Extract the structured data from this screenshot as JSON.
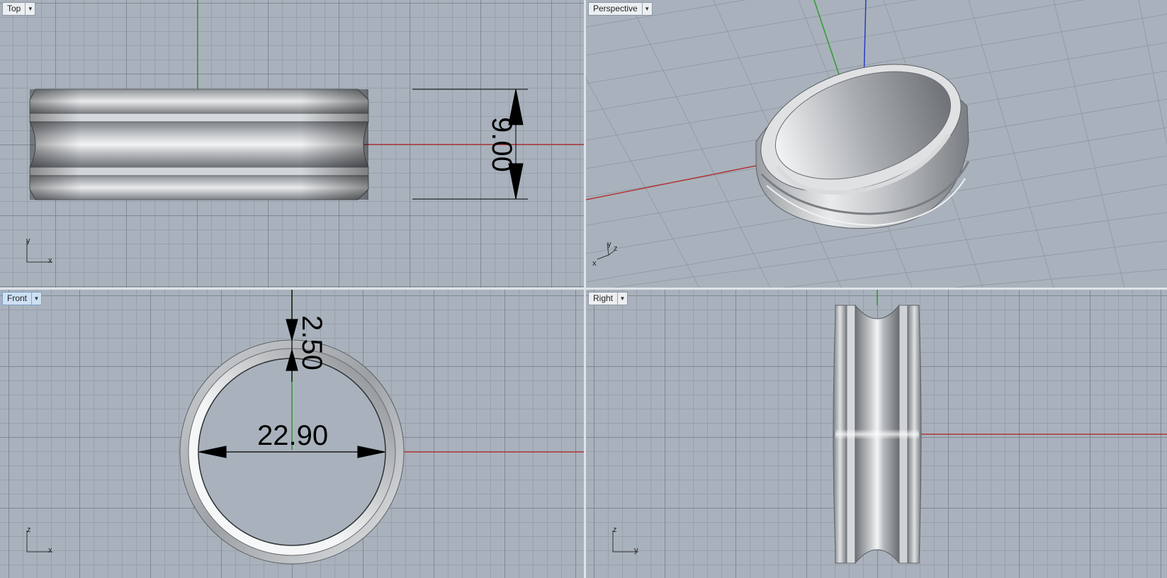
{
  "viewports": [
    {
      "name": "Top",
      "axes": [
        "y",
        "x"
      ]
    },
    {
      "name": "Perspective",
      "axes": [
        "y",
        "z",
        "x"
      ]
    },
    {
      "name": "Front",
      "axes": [
        "z",
        "x"
      ]
    },
    {
      "name": "Right",
      "axes": [
        "z",
        "y"
      ]
    }
  ],
  "dimensions": {
    "top_width": "9.00",
    "front_thickness": "2.50",
    "front_diameter": "22.90"
  },
  "colors": {
    "viewport_bg": "#a9b2bc",
    "grid_major": "#7f8893",
    "grid_minor": "#98a1ab",
    "x_axis": "#b03636",
    "y_axis": "#2f9a2f",
    "z_axis": "#2b3bc2",
    "active_tab": "#cde0f4"
  },
  "icons": {
    "viewport_menu": "dropdown-arrow-icon",
    "axis_widget": "axis-triad-icon"
  }
}
